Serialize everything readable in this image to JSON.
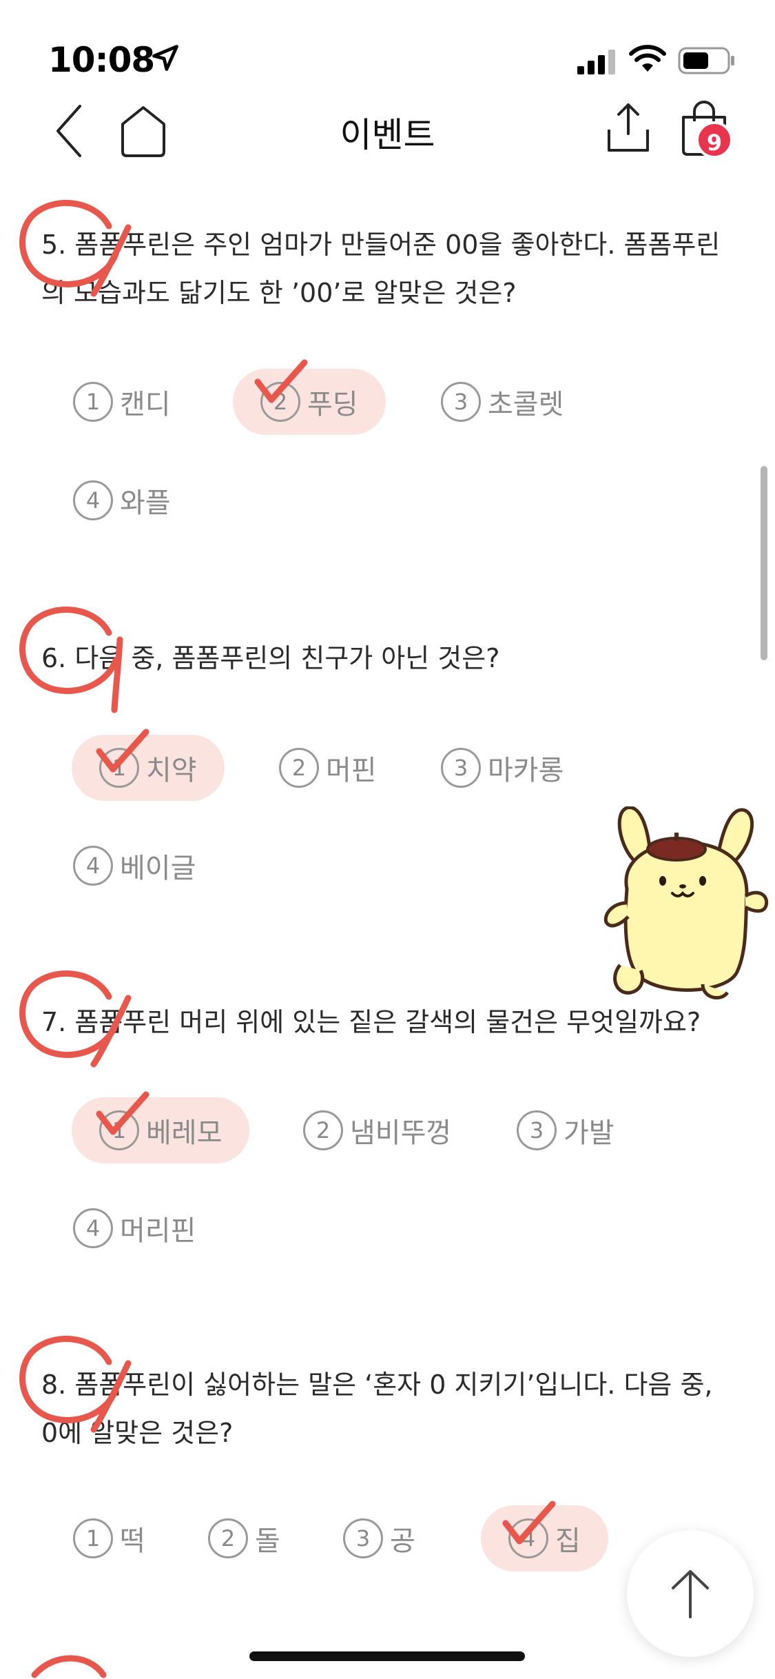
{
  "status_bar": {
    "time": "10:08"
  },
  "nav": {
    "title": "이벤트",
    "cart_count": "9"
  },
  "questions": [
    {
      "text": "5. 폼폼푸린은 주인 엄마가 만들어준 00을 좋아한다. 폼폼푸린의 모습과도 닮기도 한 ’00’로 알맞은 것은?",
      "options": [
        {
          "num": "1",
          "label": "캔디"
        },
        {
          "num": "2",
          "label": "푸딩"
        },
        {
          "num": "3",
          "label": "초콜렛"
        },
        {
          "num": "4",
          "label": "와플"
        }
      ],
      "selected": "2"
    },
    {
      "text": "6. 다음 중, 폼폼푸린의 친구가 아닌 것은?",
      "options": [
        {
          "num": "1",
          "label": "치약"
        },
        {
          "num": "2",
          "label": "머핀"
        },
        {
          "num": "3",
          "label": "마카롱"
        },
        {
          "num": "4",
          "label": "베이글"
        }
      ],
      "selected": "1"
    },
    {
      "text": "7. 폼폼푸린 머리 위에 있는 짙은 갈색의 물건은 무엇일까요?",
      "options": [
        {
          "num": "1",
          "label": "베레모"
        },
        {
          "num": "2",
          "label": "냄비뚜껑"
        },
        {
          "num": "3",
          "label": "가발"
        },
        {
          "num": "4",
          "label": "머리핀"
        }
      ],
      "selected": "1"
    },
    {
      "text": "8. 폼폼푸린이 싫어하는 말은 ‘혼자 0 지키기’입니다. 다음 중, 0에 알맞은 것은?",
      "options": [
        {
          "num": "1",
          "label": "떡"
        },
        {
          "num": "2",
          "label": "돌"
        },
        {
          "num": "3",
          "label": "공"
        },
        {
          "num": "4",
          "label": "집"
        }
      ],
      "selected": "4"
    }
  ],
  "colors": {
    "accent_red": "#e8344e",
    "mark_red": "#e8574c",
    "selected_bg": "#fbe3e0"
  },
  "icons": [
    "location-arrow-icon",
    "signal-icon",
    "wifi-icon",
    "battery-icon",
    "back-icon",
    "home-icon",
    "share-icon",
    "shopping-bag-icon",
    "arrow-up-icon"
  ]
}
